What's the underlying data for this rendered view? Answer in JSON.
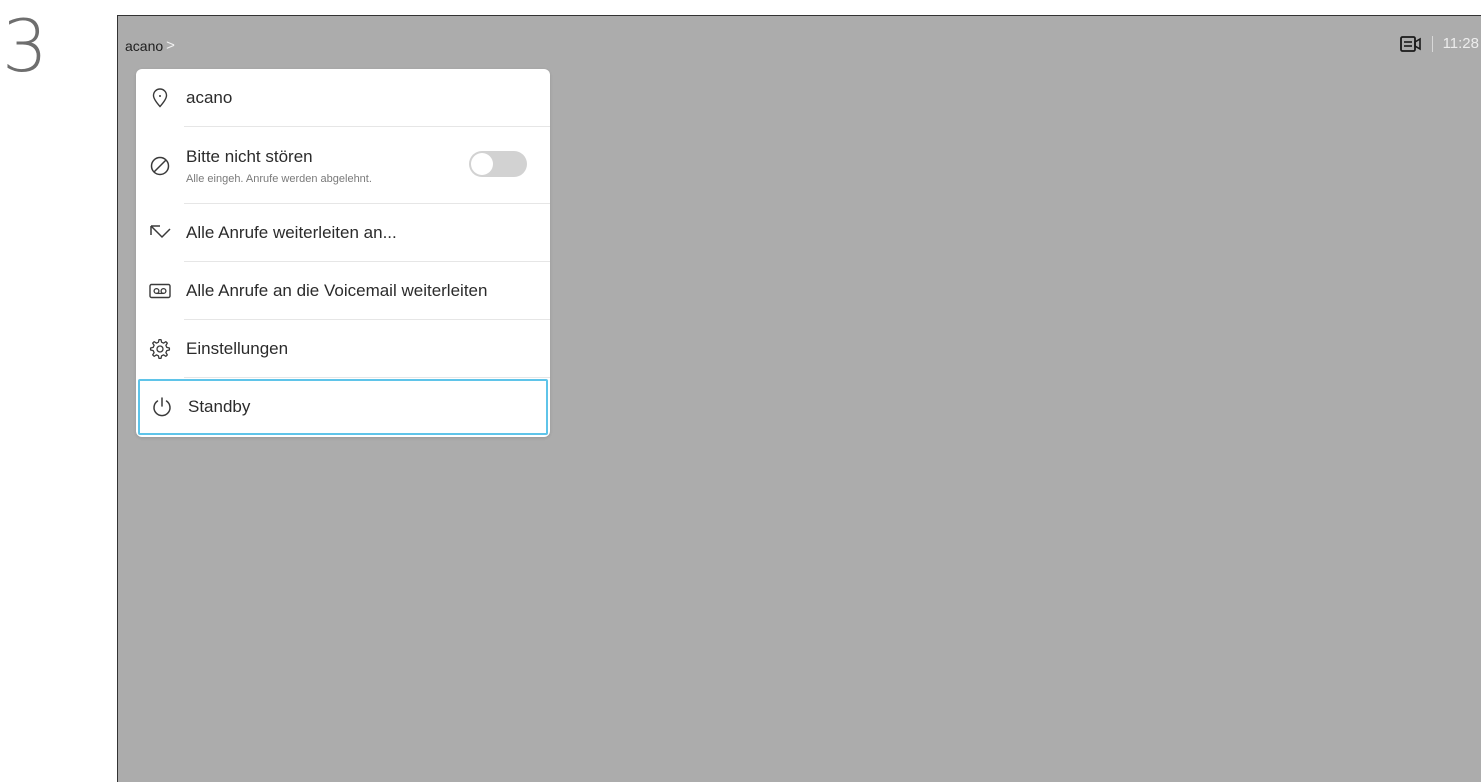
{
  "step_number": "3",
  "topbar": {
    "breadcrumb": "acano",
    "breadcrumb_chevron": ">",
    "camera_icon": "camera-control-icon",
    "clock": "11:28"
  },
  "menu": {
    "items": [
      {
        "label": "acano",
        "icon": "location-pin-icon"
      },
      {
        "label": "Bitte nicht stören",
        "sublabel": "Alle eingeh. Anrufe werden abgelehnt.",
        "icon": "do-not-disturb-icon",
        "toggle_on": false
      },
      {
        "label": "Alle Anrufe weiterleiten an...",
        "icon": "forward-arrow-icon"
      },
      {
        "label": "Alle Anrufe an die Voicemail weiterleiten",
        "icon": "voicemail-icon"
      },
      {
        "label": "Einstellungen",
        "icon": "gear-icon"
      },
      {
        "label": "Standby",
        "icon": "power-icon",
        "focused": true
      }
    ]
  },
  "colors": {
    "screen_background": "#acacac",
    "focus_ring": "#5fc4e9",
    "toggle_off": "#d2d2d2"
  }
}
